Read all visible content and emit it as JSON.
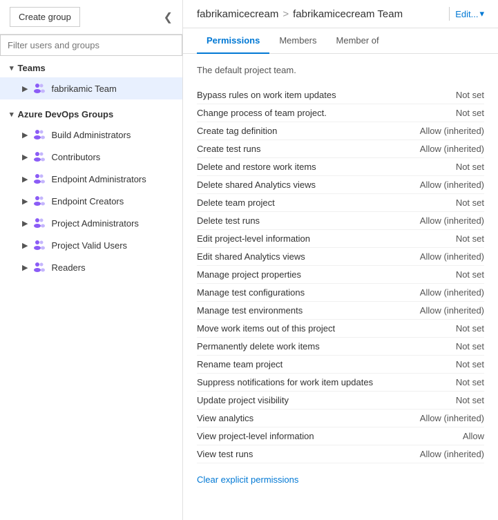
{
  "sidebar": {
    "create_group_label": "Create group",
    "filter_placeholder": "Filter users and groups",
    "collapse_icon": "❮",
    "teams_section": {
      "label": "Teams",
      "items": [
        {
          "id": "fabrikamic-team",
          "label": "fabrikamic Team",
          "active": true
        }
      ]
    },
    "azure_devops_section": {
      "label": "Azure DevOps Groups",
      "items": [
        {
          "id": "build-admins",
          "label": "Build Administrators"
        },
        {
          "id": "contributors",
          "label": "Contributors"
        },
        {
          "id": "endpoint-admins",
          "label": "Endpoint Administrators"
        },
        {
          "id": "endpoint-creators",
          "label": "Endpoint Creators"
        },
        {
          "id": "project-admins",
          "label": "Project Administrators"
        },
        {
          "id": "project-valid-users",
          "label": "Project Valid Users"
        },
        {
          "id": "readers",
          "label": "Readers"
        }
      ]
    }
  },
  "main": {
    "breadcrumb": {
      "org": "fabrikamicecream",
      "sep": ">",
      "team": "fabrikamicecream Team"
    },
    "edit_label": "Edit...",
    "tabs": [
      {
        "id": "permissions",
        "label": "Permissions",
        "active": true
      },
      {
        "id": "members",
        "label": "Members",
        "active": false
      },
      {
        "id": "member-of",
        "label": "Member of",
        "active": false
      }
    ],
    "default_team_label": "The default project team.",
    "permissions": [
      {
        "name": "Bypass rules on work item updates",
        "value": "Not set"
      },
      {
        "name": "Change process of team project.",
        "value": "Not set"
      },
      {
        "name": "Create tag definition",
        "value": "Allow (inherited)"
      },
      {
        "name": "Create test runs",
        "value": "Allow (inherited)"
      },
      {
        "name": "Delete and restore work items",
        "value": "Not set"
      },
      {
        "name": "Delete shared Analytics views",
        "value": "Allow (inherited)"
      },
      {
        "name": "Delete team project",
        "value": "Not set"
      },
      {
        "name": "Delete test runs",
        "value": "Allow (inherited)"
      },
      {
        "name": "Edit project-level information",
        "value": "Not set"
      },
      {
        "name": "Edit shared Analytics views",
        "value": "Allow (inherited)"
      },
      {
        "name": "Manage project properties",
        "value": "Not set"
      },
      {
        "name": "Manage test configurations",
        "value": "Allow (inherited)"
      },
      {
        "name": "Manage test environments",
        "value": "Allow (inherited)"
      },
      {
        "name": "Move work items out of this project",
        "value": "Not set"
      },
      {
        "name": "Permanently delete work items",
        "value": "Not set"
      },
      {
        "name": "Rename team project",
        "value": "Not set"
      },
      {
        "name": "Suppress notifications for work item updates",
        "value": "Not set"
      },
      {
        "name": "Update project visibility",
        "value": "Not set"
      },
      {
        "name": "View analytics",
        "value": "Allow (inherited)"
      },
      {
        "name": "View project-level information",
        "value": "Allow"
      },
      {
        "name": "View test runs",
        "value": "Allow (inherited)"
      }
    ],
    "clear_permissions_label": "Clear explicit permissions"
  }
}
